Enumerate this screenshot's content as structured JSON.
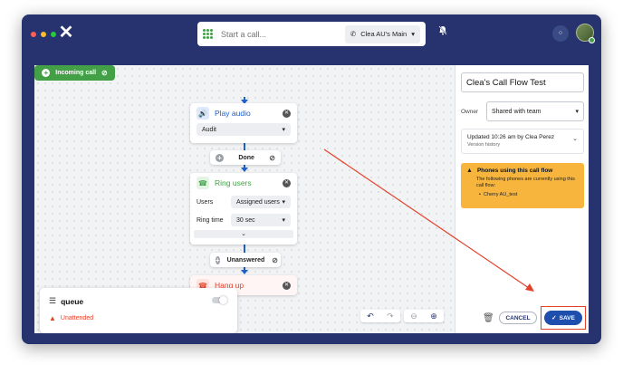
{
  "header": {
    "call_placeholder": "Start a call...",
    "line_label": "Clea AU's Main"
  },
  "flow": {
    "incoming_label": "Incoming call",
    "play_audio": {
      "title": "Play audio",
      "selected": "Audit"
    },
    "done_label": "Done",
    "ring_users": {
      "title": "Ring users",
      "users_label": "Users",
      "users_value": "Assigned users",
      "ring_time_label": "Ring time",
      "ring_time_value": "30 sec"
    },
    "unanswered_label": "Unanswered",
    "hang_up": {
      "title": "Hang up"
    }
  },
  "queue": {
    "title": "queue",
    "status": "Unattended"
  },
  "panel": {
    "title": "Clea's Call Flow Test",
    "owner_label": "Owner",
    "owner_value": "Shared with team",
    "updated_text": "Updated 10:26 am by Clea Perez",
    "version_history": "Version history",
    "warning_title": "Phones using this call flow",
    "warning_body": "The following phones are currently using this call flow:",
    "warning_item": "Cherry AU_test",
    "cancel_label": "CANCEL",
    "save_label": "SAVE"
  },
  "colors": {
    "window_bg": "#26336e",
    "green": "#43a047",
    "blue": "#1e5fc9",
    "warning": "#f7b53d",
    "danger": "#e3412a",
    "primary": "#1f4fae"
  }
}
